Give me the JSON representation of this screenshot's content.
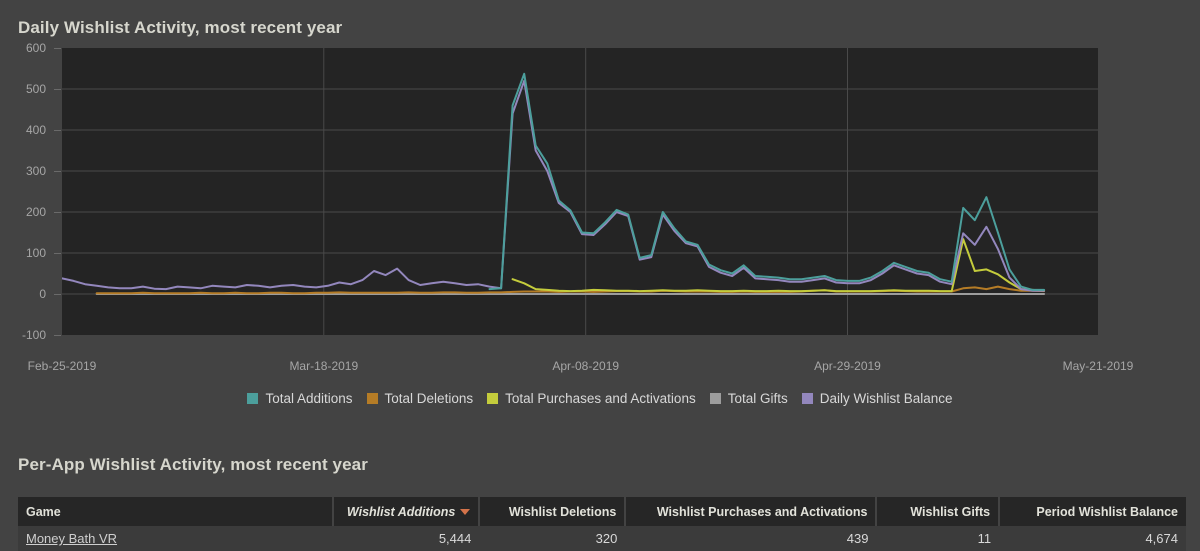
{
  "chart_section": {
    "title": "Daily Wishlist Activity, most recent year"
  },
  "table_section": {
    "title": "Per-App Wishlist Activity, most recent year"
  },
  "colors": {
    "page_bg": "#434343",
    "plot_bg": "#242424",
    "grid": "#4a4a4a",
    "axis_text": "#a6a6a6",
    "title_text": "#d6d6cd",
    "header_bg": "#262626",
    "row_bg": "#3b3b3b",
    "sort_arrow": "#d4734a",
    "additions": "#4c9f9c",
    "deletions": "#b57c26",
    "purchases": "#c4cc3c",
    "gifts": "#9d9d9d",
    "balance": "#9387bd"
  },
  "legend": {
    "items": [
      {
        "label": "Total Additions",
        "color": "#4c9f9c"
      },
      {
        "label": "Total Deletions",
        "color": "#b57c26"
      },
      {
        "label": "Total Purchases and Activations",
        "color": "#c4cc3c"
      },
      {
        "label": "Total Gifts",
        "color": "#9d9d9d"
      },
      {
        "label": "Daily Wishlist Balance",
        "color": "#9387bd"
      }
    ]
  },
  "table": {
    "columns": [
      {
        "label": "Game",
        "align": "left",
        "sorted": false,
        "width": "27%"
      },
      {
        "label": "Wishlist Additions",
        "align": "right",
        "sorted": true,
        "width": "12.5%"
      },
      {
        "label": "Wishlist Deletions",
        "align": "right",
        "sorted": false,
        "width": "12.5%"
      },
      {
        "label": "Wishlist Purchases and Activations",
        "align": "right",
        "sorted": false,
        "width": "21.5%"
      },
      {
        "label": "Wishlist Gifts",
        "align": "right",
        "sorted": false,
        "width": "10.5%"
      },
      {
        "label": "Period Wishlist Balance",
        "align": "right",
        "sorted": false,
        "width": "16%"
      }
    ],
    "rows": [
      {
        "game": "Money Bath VR",
        "wishlist_additions": "5,444",
        "wishlist_deletions": "320",
        "wishlist_purchases_and_activations": "439",
        "wishlist_gifts": "11",
        "period_wishlist_balance": "4,674"
      }
    ]
  },
  "chart_data": {
    "type": "line",
    "title": "Daily Wishlist Activity, most recent year",
    "xlabel": "",
    "ylabel": "",
    "ylim": [
      -100,
      600
    ],
    "yticks": [
      600,
      500,
      400,
      300,
      200,
      100,
      0,
      -100
    ],
    "xticks": [
      "Feb-25-2019",
      "Mar-18-2019",
      "Apr-08-2019",
      "Apr-29-2019",
      "May-21-2019"
    ],
    "xtick_positions": [
      0,
      0.2527,
      0.5055,
      0.7582,
      1.0
    ],
    "grid": true,
    "legend_position": "bottom",
    "x_start": "Feb-25-2019",
    "x_end": "May-21-2019",
    "n_points": 86,
    "series": [
      {
        "name": "Total Additions",
        "color": "#4c9f9c",
        "values": [
          null,
          null,
          null,
          null,
          null,
          null,
          null,
          null,
          null,
          null,
          null,
          null,
          null,
          null,
          null,
          null,
          null,
          null,
          null,
          null,
          null,
          null,
          null,
          null,
          null,
          null,
          null,
          null,
          null,
          null,
          null,
          null,
          null,
          null,
          null,
          null,
          null,
          12,
          14,
          460,
          537,
          362,
          318,
          228,
          204,
          150,
          148,
          175,
          205,
          194,
          88,
          95,
          200,
          160,
          128,
          120,
          72,
          58,
          50,
          70,
          44,
          42,
          40,
          36,
          36,
          40,
          44,
          34,
          32,
          32,
          40,
          56,
          76,
          66,
          56,
          52,
          36,
          30,
          210,
          180,
          236,
          150,
          60,
          18,
          10,
          10
        ]
      },
      {
        "name": "Total Deletions",
        "color": "#b57c26",
        "values": [
          null,
          null,
          null,
          2,
          2,
          2,
          2,
          3,
          2,
          2,
          2,
          2,
          3,
          2,
          2,
          3,
          2,
          2,
          3,
          3,
          2,
          2,
          3,
          3,
          4,
          3,
          3,
          3,
          3,
          3,
          4,
          3,
          3,
          4,
          4,
          3,
          3,
          4,
          4,
          5,
          6,
          6,
          6,
          5,
          6,
          6,
          5,
          6,
          7,
          7,
          6,
          6,
          8,
          7,
          6,
          6,
          6,
          5,
          5,
          6,
          5,
          5,
          5,
          5,
          6,
          8,
          9,
          6,
          6,
          6,
          6,
          7,
          8,
          7,
          6,
          6,
          6,
          6,
          14,
          16,
          12,
          18,
          12,
          8,
          8,
          7
        ]
      },
      {
        "name": "Total Purchases and Activations",
        "color": "#c4cc3c",
        "values": [
          null,
          null,
          null,
          null,
          null,
          null,
          null,
          null,
          null,
          null,
          null,
          null,
          null,
          null,
          null,
          null,
          null,
          null,
          null,
          null,
          null,
          null,
          null,
          null,
          null,
          null,
          null,
          null,
          null,
          null,
          null,
          null,
          null,
          null,
          null,
          null,
          null,
          null,
          null,
          36,
          26,
          12,
          10,
          8,
          7,
          8,
          10,
          9,
          8,
          8,
          7,
          8,
          9,
          8,
          8,
          9,
          8,
          7,
          7,
          8,
          7,
          7,
          8,
          7,
          7,
          8,
          9,
          7,
          7,
          7,
          7,
          8,
          9,
          8,
          8,
          8,
          7,
          7,
          134,
          56,
          60,
          48,
          28,
          12,
          10,
          8
        ]
      },
      {
        "name": "Total Gifts",
        "color": "#9d9d9d",
        "values": [
          null,
          null,
          null,
          0,
          0,
          0,
          0,
          0,
          0,
          0,
          0,
          0,
          0,
          0,
          0,
          0,
          0,
          0,
          0,
          0,
          0,
          0,
          0,
          0,
          0,
          0,
          0,
          0,
          0,
          0,
          0,
          0,
          0,
          0,
          0,
          0,
          0,
          0,
          0,
          0,
          0,
          0,
          0,
          0,
          0,
          0,
          0,
          0,
          0,
          0,
          0,
          0,
          0,
          0,
          0,
          0,
          0,
          0,
          0,
          0,
          0,
          0,
          0,
          0,
          0,
          0,
          0,
          0,
          0,
          0,
          0,
          0,
          0,
          0,
          0,
          0,
          0,
          0,
          0,
          0,
          0,
          0,
          0,
          0,
          0,
          0
        ]
      },
      {
        "name": "Daily Wishlist Balance",
        "color": "#9387bd",
        "values": [
          38,
          32,
          24,
          20,
          16,
          14,
          14,
          18,
          13,
          12,
          18,
          16,
          14,
          20,
          18,
          16,
          22,
          20,
          16,
          20,
          22,
          18,
          16,
          20,
          28,
          24,
          34,
          56,
          46,
          62,
          34,
          22,
          26,
          30,
          26,
          22,
          24,
          18,
          14,
          440,
          520,
          350,
          300,
          222,
          200,
          146,
          144,
          170,
          200,
          190,
          84,
          90,
          194,
          154,
          124,
          116,
          66,
          52,
          44,
          64,
          38,
          36,
          34,
          30,
          30,
          34,
          38,
          28,
          26,
          26,
          34,
          50,
          70,
          60,
          50,
          46,
          30,
          24,
          148,
          120,
          164,
          110,
          40,
          12,
          8,
          8
        ]
      }
    ]
  }
}
